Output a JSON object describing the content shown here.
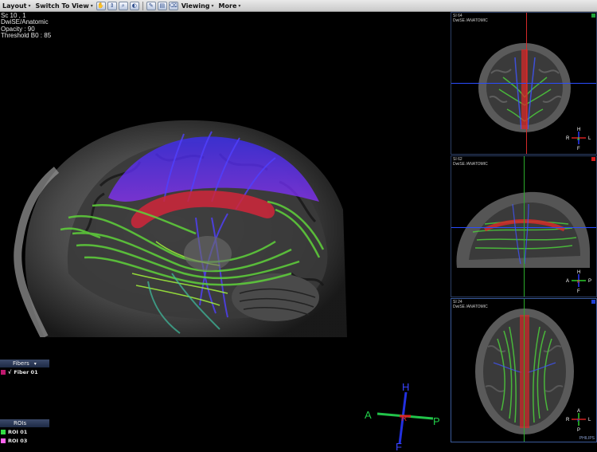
{
  "toolbar": {
    "layout": "Layout",
    "switch_to_view": "Switch To View",
    "viewing": "Viewing",
    "more": "More",
    "icons": [
      "hand-icon",
      "slider-icon",
      "zoom-icon",
      "window-level-icon",
      "pen-icon",
      "layers-icon",
      "eraser-icon"
    ]
  },
  "overlay": {
    "line1": "Sc 10 , 1",
    "line2": "DwiSE/Anatomic",
    "line3": "Opacity : 90",
    "line4": "Threshold B0 : 85"
  },
  "fibers": {
    "header": "Fibers",
    "items": [
      {
        "mark": "√",
        "label": "Fiber 01",
        "color": "#c0186e"
      }
    ]
  },
  "rois": {
    "header": "ROIs",
    "items": [
      {
        "label": "ROI 01",
        "color": "#33dd44"
      },
      {
        "label": "ROI 03",
        "color": "#ff66ee"
      }
    ]
  },
  "orientation_main": {
    "top": "H",
    "bottom": "F",
    "left": "A",
    "right": "P",
    "center": "R"
  },
  "panels": {
    "coronal": {
      "slice": "SI 64",
      "series": "DwiSE /ANATOMIC",
      "marker_color": "#1fa33a",
      "orient": {
        "top": "H",
        "bottom": "F",
        "left": "R",
        "right": "L",
        "center": "A"
      }
    },
    "sagittal": {
      "slice": "SI 62",
      "series": "DwiSE /ANATOMIC",
      "marker_color": "#d21a1a",
      "orient": {
        "top": "H",
        "bottom": "F",
        "left": "A",
        "right": "P",
        "center": "R"
      }
    },
    "axial": {
      "slice": "SI 24",
      "series": "DwiSE /ANATOMIC",
      "marker_color": "#1e3fd6",
      "orient": {
        "top": "A",
        "bottom": "P",
        "left": "R",
        "right": "L",
        "center": "F"
      },
      "logo": "PHILIPS"
    }
  }
}
